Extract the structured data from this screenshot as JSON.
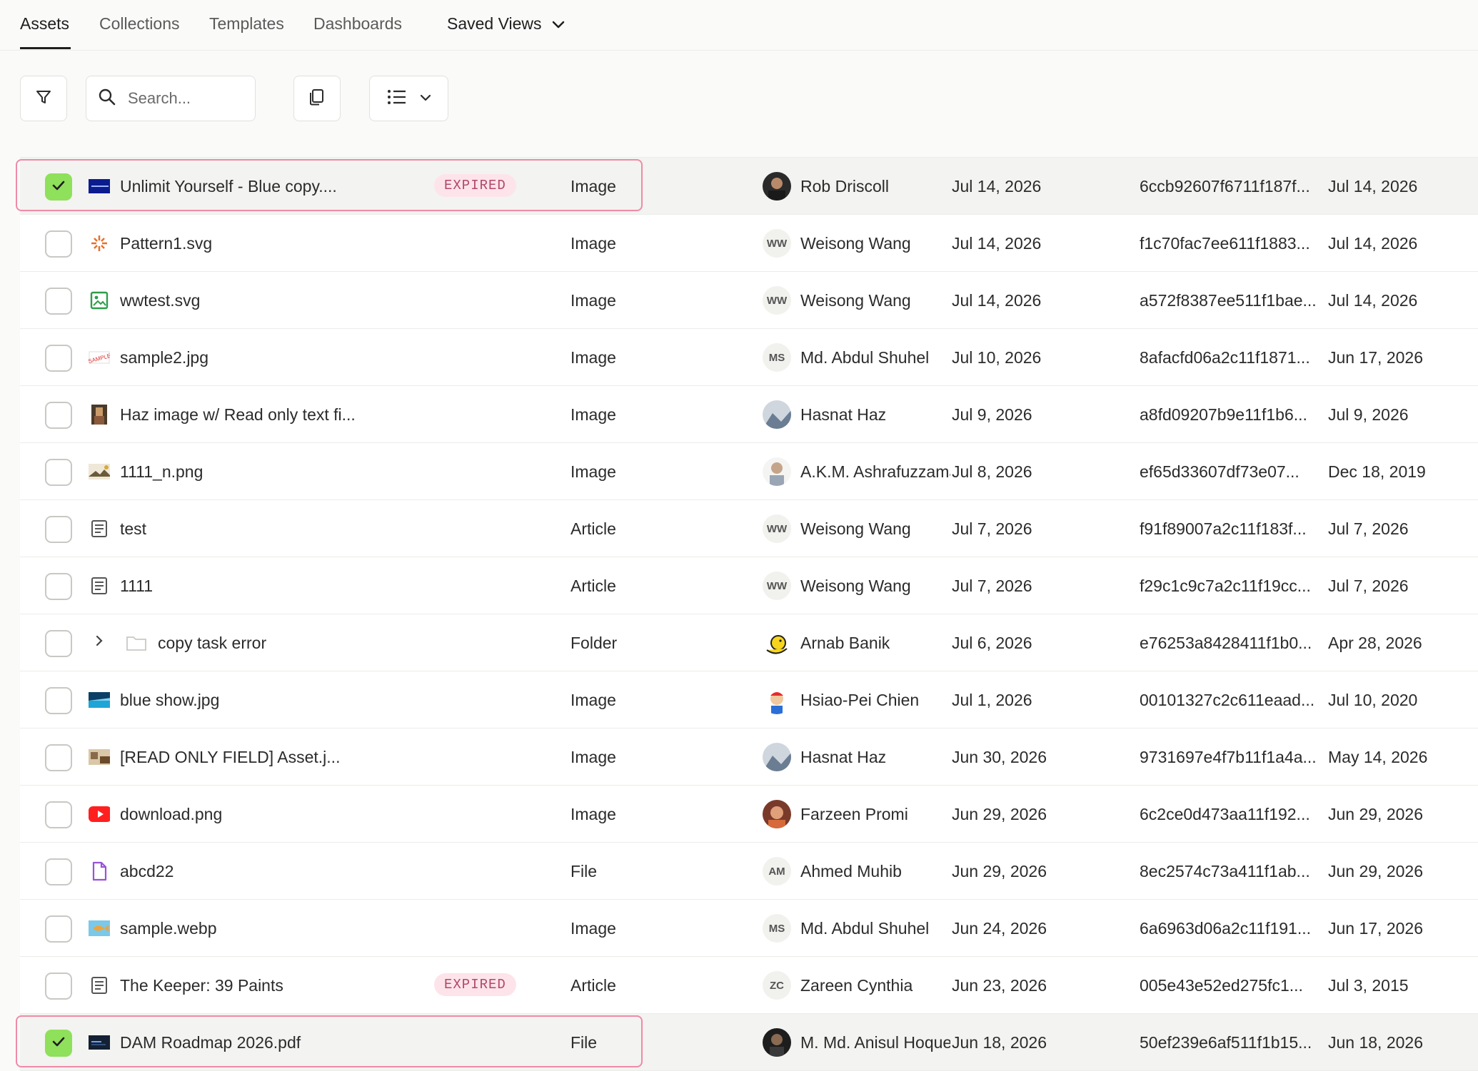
{
  "tabs": [
    "Assets",
    "Collections",
    "Templates",
    "Dashboards"
  ],
  "saved_views_label": "Saved Views",
  "search": {
    "placeholder": "Search..."
  },
  "rows": [
    {
      "name": "Unlimit Yourself - Blue copy....",
      "badge": "EXPIRED",
      "type": "Image",
      "owner": "Rob Driscoll",
      "created": "Jul 14, 2026",
      "hash": "6ccb92607f6711f187f...",
      "modified": "Jul 14, 2026",
      "checked": true
    },
    {
      "name": "Pattern1.svg",
      "badge": "",
      "type": "Image",
      "owner": "Weisong Wang",
      "initials": "WW",
      "created": "Jul 14, 2026",
      "hash": "f1c70fac7ee611f1883...",
      "modified": "Jul 14, 2026",
      "checked": false
    },
    {
      "name": "wwtest.svg",
      "badge": "",
      "type": "Image",
      "owner": "Weisong Wang",
      "initials": "WW",
      "created": "Jul 14, 2026",
      "hash": "a572f8387ee511f1bae...",
      "modified": "Jul 14, 2026",
      "checked": false
    },
    {
      "name": "sample2.jpg",
      "badge": "",
      "type": "Image",
      "owner": "Md. Abdul Shuhel",
      "initials": "MS",
      "created": "Jul 10, 2026",
      "hash": "8afacfd06a2c11f1871...",
      "modified": "Jun 17, 2026",
      "checked": false
    },
    {
      "name": "Haz image w/ Read only text fi...",
      "badge": "",
      "type": "Image",
      "owner": "Hasnat Haz",
      "created": "Jul 9, 2026",
      "hash": "a8fd09207b9e11f1b6...",
      "modified": "Jul 9, 2026",
      "checked": false
    },
    {
      "name": "1111_n.png",
      "badge": "",
      "type": "Image",
      "owner": "A.K.M. Ashrafuzzaman",
      "created": "Jul 8, 2026",
      "hash": "ef65d33607df73e07...",
      "modified": "Dec 18, 2019",
      "checked": false
    },
    {
      "name": "test",
      "badge": "",
      "type": "Article",
      "owner": "Weisong Wang",
      "initials": "WW",
      "created": "Jul 7, 2026",
      "hash": "f91f89007a2c11f183f...",
      "modified": "Jul 7, 2026",
      "checked": false
    },
    {
      "name": "1111",
      "badge": "",
      "type": "Article",
      "owner": "Weisong Wang",
      "initials": "WW",
      "created": "Jul 7, 2026",
      "hash": "f29c1c9c7a2c11f19cc...",
      "modified": "Jul 7, 2026",
      "checked": false
    },
    {
      "name": "copy task error",
      "badge": "",
      "type": "Folder",
      "owner": "Arnab Banik",
      "created": "Jul 6, 2026",
      "hash": "e76253a8428411f1b0...",
      "modified": "Apr 28, 2026",
      "checked": false
    },
    {
      "name": "blue show.jpg",
      "badge": "",
      "type": "Image",
      "owner": "Hsiao-Pei Chien",
      "created": "Jul 1, 2026",
      "hash": "00101327c2c611eaad...",
      "modified": "Jul 10, 2020",
      "checked": false
    },
    {
      "name": "[READ ONLY FIELD] Asset.j...",
      "badge": "",
      "type": "Image",
      "owner": "Hasnat Haz",
      "created": "Jun 30, 2026",
      "hash": "9731697e4f7b11f1a4a...",
      "modified": "May 14, 2026",
      "checked": false
    },
    {
      "name": "download.png",
      "badge": "",
      "type": "Image",
      "owner": "Farzeen Promi",
      "created": "Jun 29, 2026",
      "hash": "6c2ce0d473aa11f192...",
      "modified": "Jun 29, 2026",
      "checked": false
    },
    {
      "name": "abcd22",
      "badge": "",
      "type": "File",
      "owner": "Ahmed Muhib",
      "initials": "AM",
      "created": "Jun 29, 2026",
      "hash": "8ec2574c73a411f1ab...",
      "modified": "Jun 29, 2026",
      "checked": false
    },
    {
      "name": "sample.webp",
      "badge": "",
      "type": "Image",
      "owner": "Md. Abdul Shuhel",
      "initials": "MS",
      "created": "Jun 24, 2026",
      "hash": "6a6963d06a2c11f191...",
      "modified": "Jun 17, 2026",
      "checked": false
    },
    {
      "name": "The Keeper: 39 Paints",
      "badge": "EXPIRED",
      "type": "Article",
      "owner": "Zareen Cynthia",
      "initials": "ZC",
      "created": "Jun 23, 2026",
      "hash": "005e43e52ed275fc1...",
      "modified": "Jul 3, 2015",
      "checked": false
    },
    {
      "name": "DAM Roadmap 2026.pdf",
      "badge": "",
      "type": "File",
      "owner": "M. Md. Anisul Hoque",
      "created": "Jun 18, 2026",
      "hash": "50ef239e6af511f1b15...",
      "modified": "Jun 18, 2026",
      "checked": true
    }
  ]
}
